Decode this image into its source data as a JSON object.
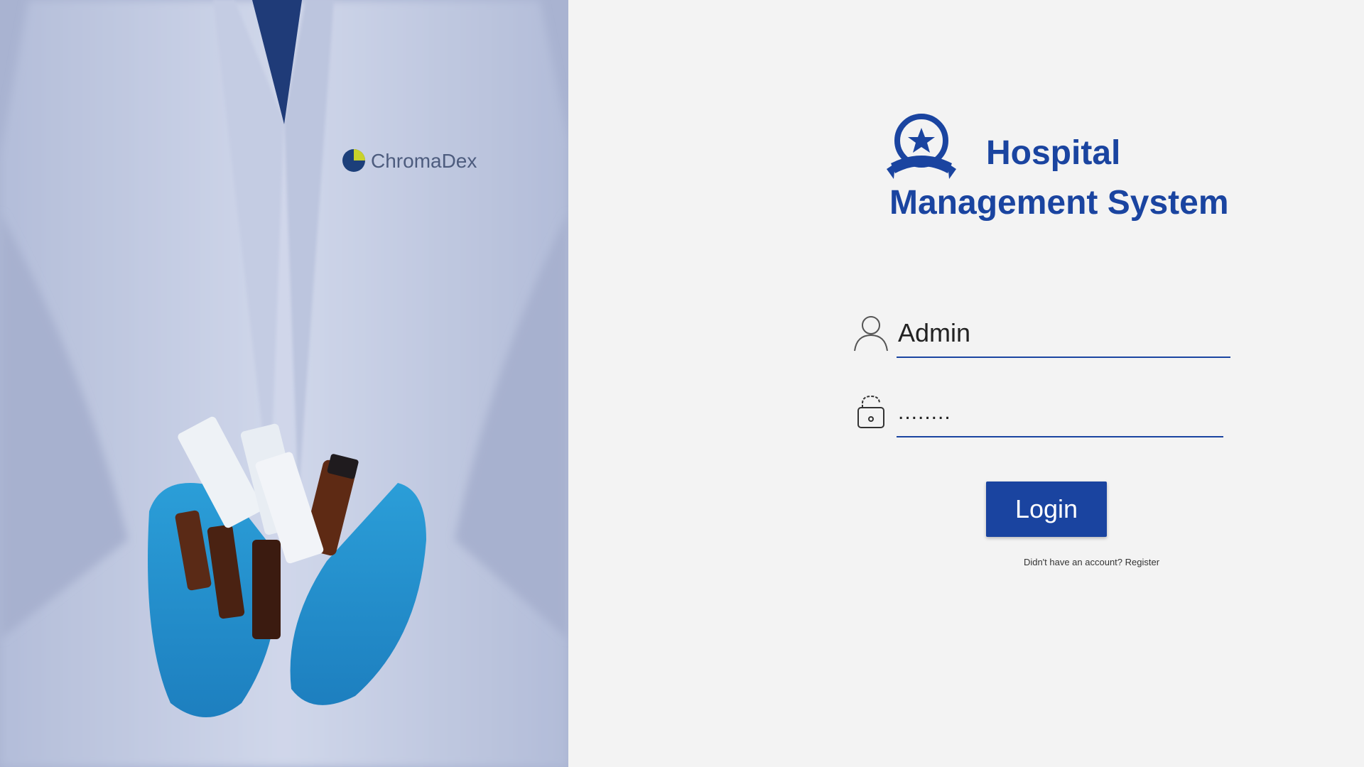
{
  "hero": {
    "coat_logo_text": "ChromaDex"
  },
  "brand": {
    "title_line_1": "Hospital",
    "title_line_2": "Management System",
    "logo_icon": "award-badge-icon",
    "accent_color": "#1a44a0"
  },
  "login_form": {
    "username": {
      "icon": "user-icon",
      "value": "Admin"
    },
    "password": {
      "icon": "lock-icon",
      "value": "........"
    },
    "login_label": "Login",
    "register_prompt": "Didn't have an account?",
    "register_link": "Register"
  }
}
